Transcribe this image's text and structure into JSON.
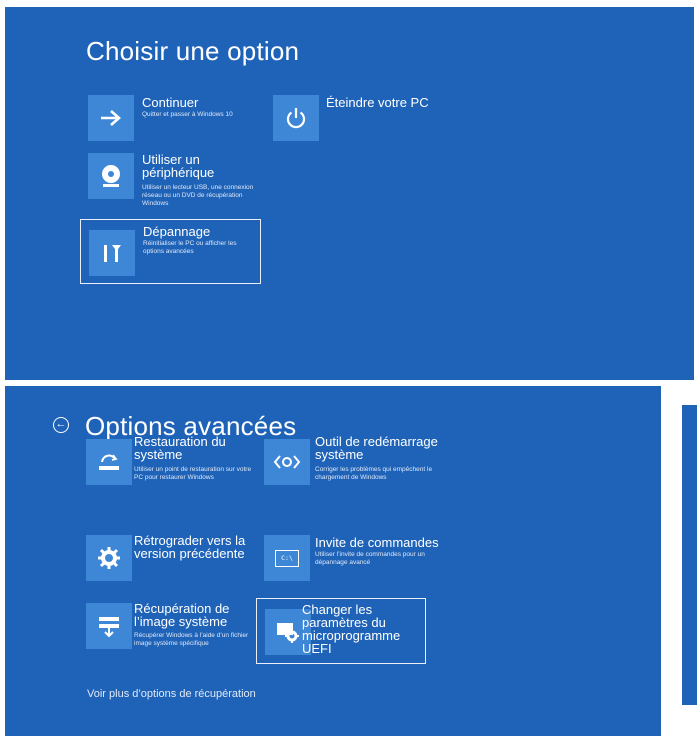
{
  "panel1": {
    "title": "Choisir une option",
    "options": [
      {
        "title": "Continuer",
        "desc": "Quitter et passer à Windows 10",
        "icon": "arrow-right-icon"
      },
      {
        "title": "Éteindre votre PC",
        "desc": "",
        "icon": "power-icon"
      },
      {
        "title": "Utiliser un\npériphérique",
        "desc": "Utiliser un lecteur USB, une connexion réseau ou un DVD de récupération Windows",
        "icon": "disc-icon"
      },
      {
        "title": "Dépannage",
        "desc": "Réinitialiser le PC ou afficher les options avancées",
        "icon": "tools-icon"
      }
    ]
  },
  "panel2": {
    "title": "Options avancées",
    "back_glyph": "←",
    "options": [
      {
        "title": "Restauration du\nsystème",
        "desc": "Utiliser un point de restauration sur votre PC pour restaurer Windows",
        "icon": "system-restore-icon"
      },
      {
        "title": "Outil de redémarrage\nsystème",
        "desc": "Corriger les problèmes qui empêchent le chargement de Windows",
        "icon": "startup-repair-icon"
      },
      {
        "title": "Rétrograder vers la\nversion précédente",
        "desc": "",
        "icon": "gear-icon"
      },
      {
        "title": "Invite de commandes",
        "desc": "Utiliser l’invite de commandes pour un dépannage avancé",
        "icon": "command-prompt-icon"
      },
      {
        "title": "Récupération de\nl’image système",
        "desc": "Récupérer Windows à l’aide d’un fichier image système spécifique",
        "icon": "image-recovery-icon"
      },
      {
        "title": "Changer les\nparamètres du\nmicroprogramme\nUEFI",
        "desc": "",
        "icon": "uefi-settings-icon"
      }
    ],
    "more_link": "Voir plus d’options de récupération",
    "cmd_icon_text": "C:\\"
  },
  "colors": {
    "panel": "#1f63b8",
    "tile_icon": "#3e86d6"
  }
}
